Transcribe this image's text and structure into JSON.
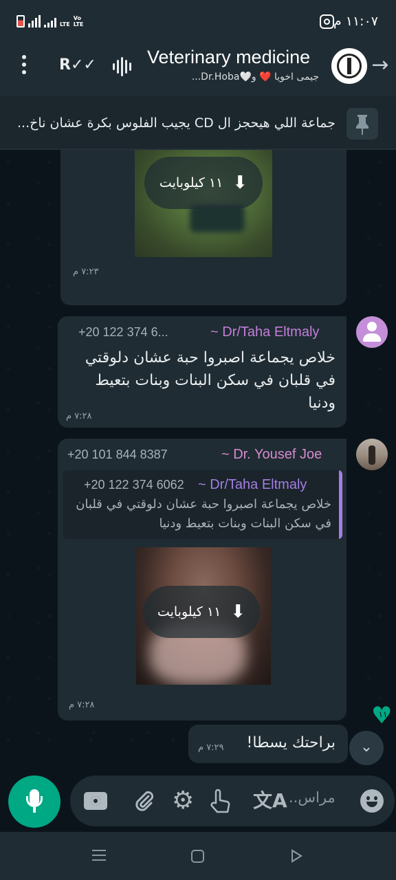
{
  "status_bar": {
    "time": "١١:٠٧ م",
    "network": "LTE",
    "volte": "Vo LTE"
  },
  "header": {
    "title": "Veterinary medicine",
    "subtitle": "جيمى اخويا ❤️ و🤍Dr.Hoba..."
  },
  "pinned": {
    "text": "جماعة اللي هيحجز ال CD يجيب الفلوس بكرة عشان ناخ..."
  },
  "messages": [
    {
      "type": "media",
      "download_size": "١١ كيلوبايت",
      "time": "٧:٢٣ م"
    },
    {
      "type": "text",
      "sender": "~ Dr/Taha Eltmaly",
      "phone": "+20 122 374 6...",
      "text": "خلاص يجماعة اصبروا حبة عشان دلوقتي في قلبان في سكن البنات وبنات بتعيط ودنيا",
      "time": "٧:٢٨ م"
    },
    {
      "type": "media_reply",
      "sender": "~ Dr. Yousef Joe",
      "phone": "+20 101 844 8387",
      "quote": {
        "sender": "~ Dr/Taha Eltmaly",
        "phone": "+20 122 374 6062",
        "text": "خلاص يجماعة اصبروا حبة عشان دلوقتي في قلبان في سكن البنات وبنات بتعيط ودنيا"
      },
      "download_size": "١١ كيلوبايت",
      "time": "٧:٢٨ م"
    },
    {
      "type": "text",
      "text": "براحتك يسطا!",
      "time": "٧:٢٩ م"
    }
  ],
  "unread_count": "١١",
  "input": {
    "placeholder": "مراس.."
  },
  "colors": {
    "accent": "#00a884",
    "bubble": "#1f2c33",
    "sender_taha": "#c47fd8",
    "sender_yousef": "#d78bd0",
    "quote_sender": "#a57ee6"
  }
}
